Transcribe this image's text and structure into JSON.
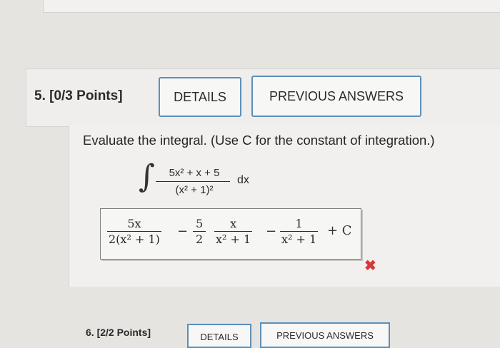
{
  "question5": {
    "label": "5. [0/3 Points]",
    "details_button": "DETAILS",
    "previous_answers_button": "PREVIOUS ANSWERS",
    "prompt": "Evaluate the integral. (Use C for the constant of integration.)",
    "integral": {
      "sign": "∫",
      "numerator": "5x² + x + 5",
      "denominator": "(x² + 1)²",
      "differential": "dx"
    },
    "answer": {
      "term1_numerator": "5x",
      "term1_denominator": "2(x² + 1)",
      "op1": "−",
      "term2_numerator": "5",
      "term2_denominator": "2",
      "term3_numerator": "x",
      "term3_denominator": "x² + 1",
      "op2": "−",
      "term4_numerator": "1",
      "term4_denominator": "x² + 1",
      "constant": "+ C"
    },
    "status_mark": "✖",
    "status_color": "#d73838"
  },
  "question6": {
    "label": "6. [2/2 Points]",
    "details_button": "DETAILS",
    "previous_answers_button": "PREVIOUS ANSWERS"
  },
  "accent_color": "#5c8fb8"
}
